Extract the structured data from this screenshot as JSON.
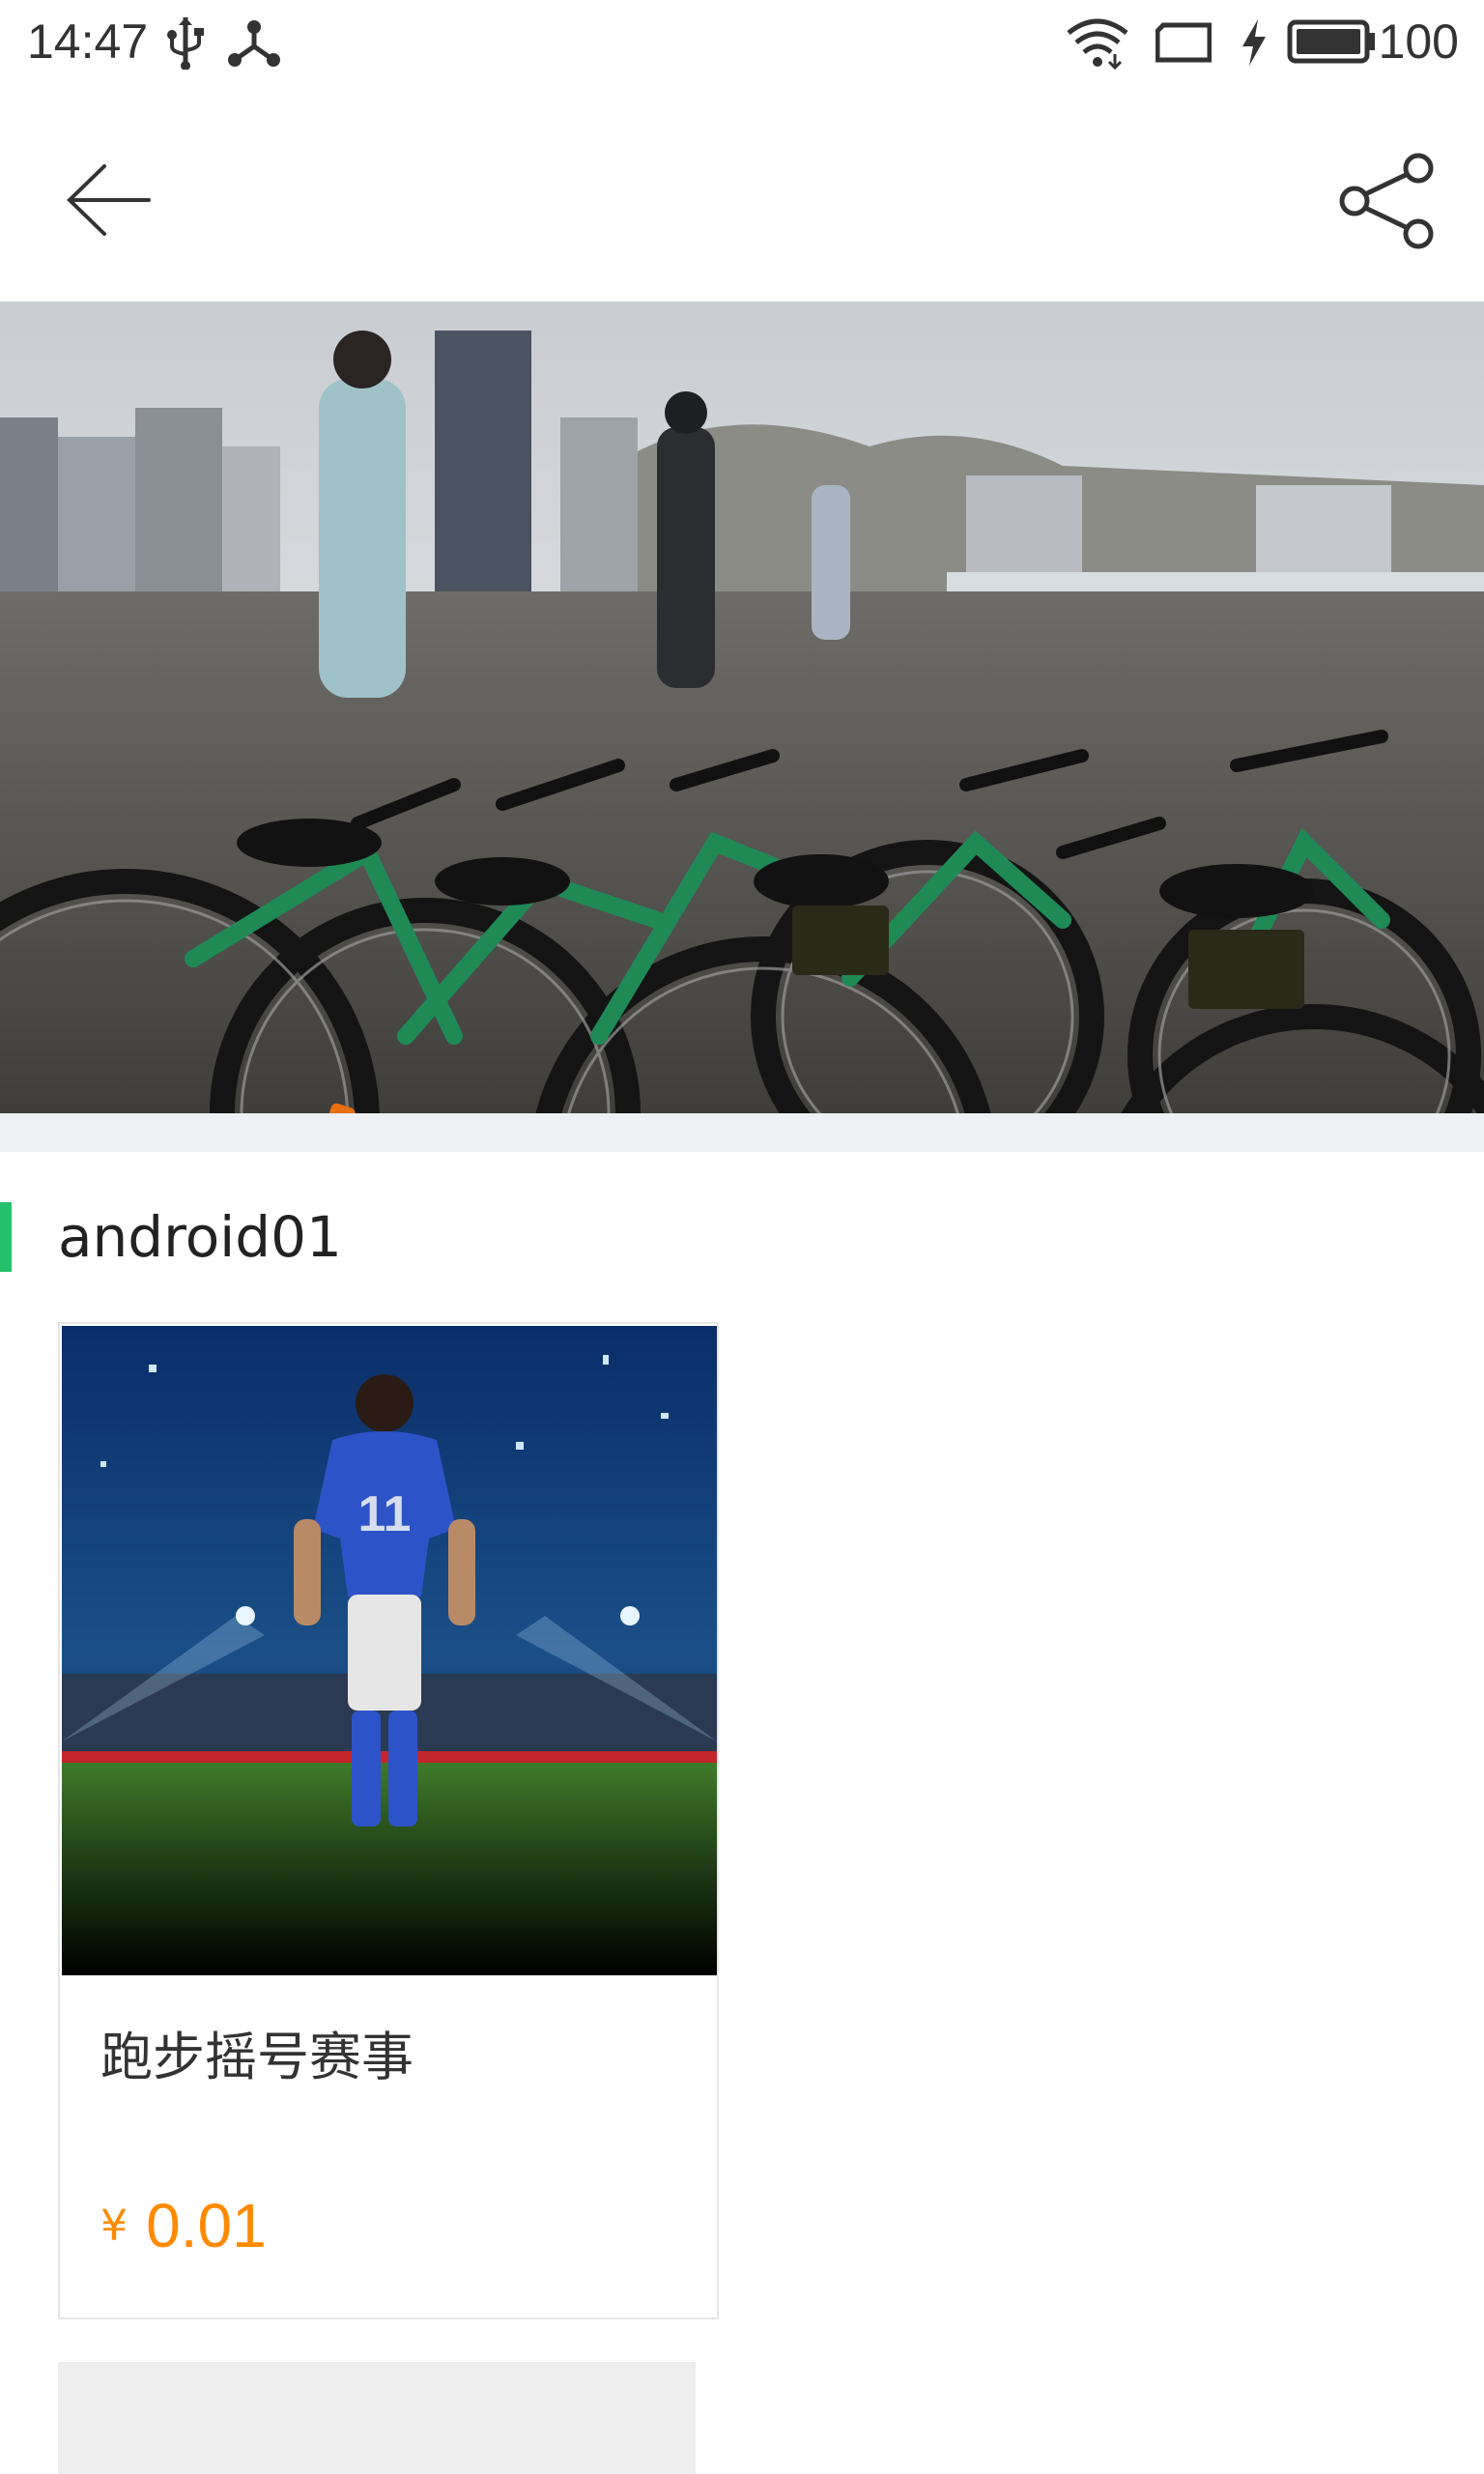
{
  "status_bar": {
    "time": "14:47",
    "battery": "100",
    "icons": [
      "usb-icon",
      "share-network-icon",
      "wifi-icon",
      "screen-rotate-icon",
      "charging-icon",
      "battery-icon"
    ]
  },
  "toolbar": {
    "back_icon": "arrow-left-icon",
    "share_icon": "share-icon"
  },
  "banner": {
    "image": "bicycles-on-waterfront-photo"
  },
  "section": {
    "title": "android01",
    "accent_color": "#23c16b"
  },
  "products": [
    {
      "title": "跑步摇号赛事",
      "currency": "¥",
      "price": "0.01",
      "image": "soccer-player-stadium-photo",
      "price_color": "#ff8a00"
    }
  ]
}
